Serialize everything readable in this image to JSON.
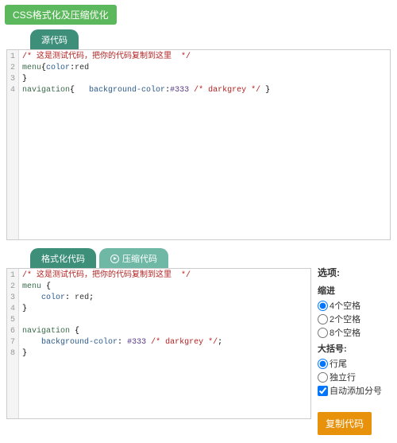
{
  "header": {
    "title": "CSS格式化及压缩优化"
  },
  "source_panel": {
    "tab_label": "源代码",
    "lines": [
      {
        "n": "1",
        "html": "<span class='c-comment'>/* 这是测试代码，把你的代码复制到这里  */</span>"
      },
      {
        "n": "2",
        "html": "<span class='c-sel'>menu</span>{<span class='c-prop'>color</span>:<span class='c-val'>red</span>"
      },
      {
        "n": "3",
        "html": "}"
      },
      {
        "n": "4",
        "html": "<span class='c-sel'>navigation</span>{   <span class='c-prop'>background-color</span>:<span class='c-hex'>#333</span> <span class='c-comment'>/* darkgrey */</span> }"
      }
    ]
  },
  "output_panel": {
    "tab_format": "格式化代码",
    "tab_compress": "压缩代码",
    "lines": [
      {
        "n": "1",
        "html": "<span class='c-comment'>/* 这是测试代码，把你的代码复制到这里  */</span>"
      },
      {
        "n": "2",
        "html": "<span class='c-sel'>menu</span> {"
      },
      {
        "n": "3",
        "html": "    <span class='c-prop'>color</span>: <span class='c-val'>red</span>;"
      },
      {
        "n": "4",
        "html": "}"
      },
      {
        "n": "5",
        "html": ""
      },
      {
        "n": "6",
        "html": "<span class='c-sel'>navigation</span> {"
      },
      {
        "n": "7",
        "html": "    <span class='c-prop'>background-color</span>: <span class='c-hex'>#333</span> <span class='c-comment'>/* darkgrey */</span>;"
      },
      {
        "n": "8",
        "html": "}"
      }
    ]
  },
  "options": {
    "heading": "选项:",
    "indent_title": "缩进",
    "indent_opts": [
      {
        "label": "4个空格",
        "checked": true
      },
      {
        "label": "2个空格",
        "checked": false
      },
      {
        "label": "8个空格",
        "checked": false
      }
    ],
    "brace_title": "大括号:",
    "brace_opts": [
      {
        "label": "行尾",
        "checked": true
      },
      {
        "label": "独立行",
        "checked": false
      }
    ],
    "semicolon_label": "自动添加分号",
    "semicolon_checked": true,
    "copy_button": "复制代码"
  }
}
